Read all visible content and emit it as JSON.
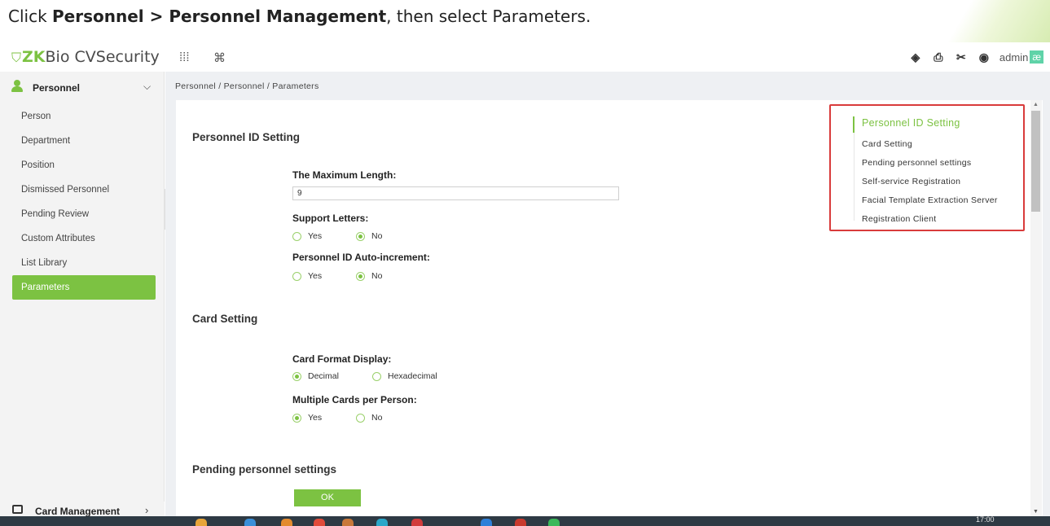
{
  "instruction": {
    "prefix": "Click ",
    "bold1": "Personnel",
    "sep": " > ",
    "bold2": "Personnel Management",
    "suffix": ", then select Parameters."
  },
  "app": {
    "logo_mark": "ZK",
    "logo_rest": "Bio CVSecurity",
    "user": "admin",
    "badge": "æ"
  },
  "topbar": {
    "icons": [
      "apps-grid-icon",
      "command-icon",
      "compass-icon",
      "print-icon",
      "tools-icon",
      "user-circle-icon"
    ]
  },
  "sidebar": {
    "module": "Personnel",
    "items": [
      {
        "label": "Person"
      },
      {
        "label": "Department"
      },
      {
        "label": "Position"
      },
      {
        "label": "Dismissed Personnel"
      },
      {
        "label": "Pending Review"
      },
      {
        "label": "Custom Attributes"
      },
      {
        "label": "List Library"
      },
      {
        "label": "Parameters",
        "active": true
      }
    ],
    "footer_module": "Card Management"
  },
  "breadcrumb": "Personnel / Personnel / Parameters",
  "personnel_id": {
    "title": "Personnel ID Setting",
    "max_length_label": "The Maximum Length:",
    "max_length_value": "9",
    "support_letters_label": "Support Letters:",
    "auto_increment_label": "Personnel ID Auto-increment:",
    "yes": "Yes",
    "no": "No"
  },
  "card_setting": {
    "title": "Card Setting",
    "format_label": "Card Format Display:",
    "decimal": "Decimal",
    "hexadecimal": "Hexadecimal",
    "multi_label": "Multiple Cards per Person:",
    "yes": "Yes",
    "no": "No"
  },
  "pending": {
    "title": "Pending personnel settings"
  },
  "ok_label": "OK",
  "anchors": [
    {
      "label": "Personnel ID Setting",
      "active": true
    },
    {
      "label": "Card Setting"
    },
    {
      "label": "Pending personnel settings"
    },
    {
      "label": "Self-service Registration"
    },
    {
      "label": "Facial Template Extraction Server"
    },
    {
      "label": "Registration Client"
    }
  ],
  "taskbar": {
    "time": "17:00"
  },
  "colors": {
    "accent": "#7cc242",
    "highlight_box": "#d93b3b"
  }
}
